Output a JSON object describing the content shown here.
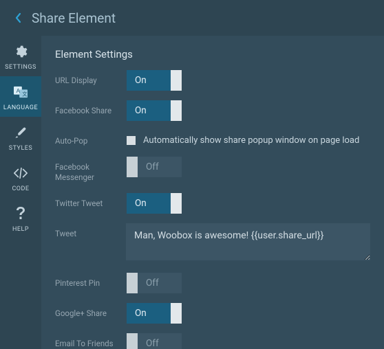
{
  "header": {
    "title": "Share Element"
  },
  "sidebar": {
    "items": [
      {
        "label": "SETTINGS"
      },
      {
        "label": "LANGUAGE"
      },
      {
        "label": "STYLES"
      },
      {
        "label": "CODE"
      },
      {
        "label": "HELP"
      }
    ]
  },
  "content": {
    "title": "Element Settings"
  },
  "toggle": {
    "on_label": "On",
    "off_label": "Off"
  },
  "settings": {
    "url_display": {
      "label": "URL Display",
      "state": "on"
    },
    "facebook_share": {
      "label": "Facebook Share",
      "state": "on"
    },
    "auto_pop": {
      "label": "Auto-Pop",
      "checkbox_label": "Automatically show share popup window on page load"
    },
    "facebook_messenger": {
      "label": "Facebook Messenger",
      "state": "off"
    },
    "twitter_tweet": {
      "label": "Twitter Tweet",
      "state": "on"
    },
    "tweet": {
      "label": "Tweet",
      "value": "Man, Woobox is awesome! {{user.share_url}}"
    },
    "pinterest_pin": {
      "label": "Pinterest Pin",
      "state": "off"
    },
    "google_plus_share": {
      "label": "Google+ Share",
      "state": "on"
    },
    "email_to_friends": {
      "label": "Email To Friends",
      "state": "off"
    }
  }
}
